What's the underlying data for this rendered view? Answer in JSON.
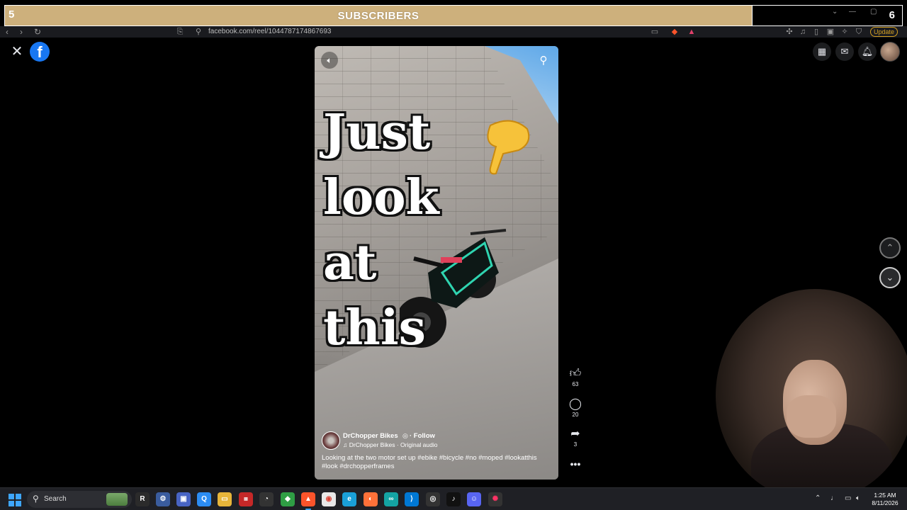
{
  "overlay": {
    "title": "SUBSCRIBERS",
    "left_count": "5",
    "right_count": "6"
  },
  "browser": {
    "url": "facebook.com/reel/1044787174867693",
    "update_label": "Update"
  },
  "reel": {
    "overlay_text": [
      "Just",
      "look",
      "at",
      "this"
    ],
    "author": "DrChopper Bikes",
    "follow": "· Follow",
    "audio": "DrChopper Bikes · Original audio",
    "caption": "Looking at the two motor set up #ebike #bicycle #no #moped #lookatthis #look #drchopperframes",
    "likes": "63",
    "comments": "20",
    "shares": "3"
  },
  "taskbar": {
    "search_placeholder": "Search",
    "time": "1:25 AM",
    "date": "8/11/2026"
  },
  "colors": {
    "banner": "#cdb07c",
    "fb_blue": "#1877f2",
    "accent": "#3ea6ff"
  }
}
